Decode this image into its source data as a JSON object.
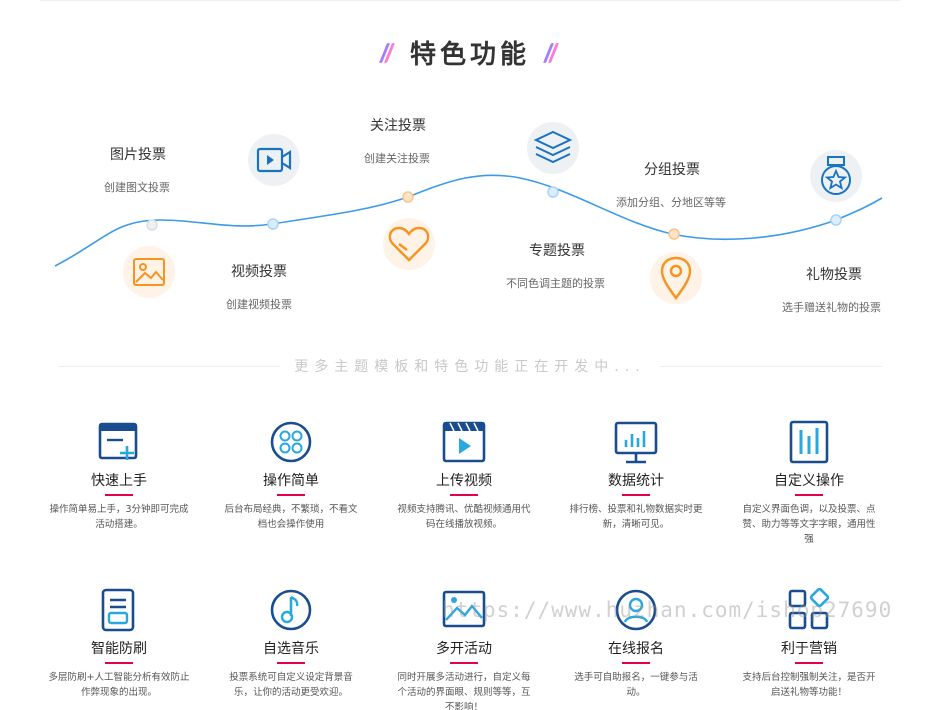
{
  "title": "特色功能",
  "timeline": [
    {
      "label": "图片投票",
      "sub": "创建图文投票",
      "icon": "image-icon"
    },
    {
      "label": "视频投票",
      "sub": "创建视频投票",
      "icon": "video-camera-icon"
    },
    {
      "label": "关注投票",
      "sub": "创建关注投票",
      "icon": "heart-icon"
    },
    {
      "label": "专题投票",
      "sub": "不同色调主题的投票",
      "icon": "layers-icon"
    },
    {
      "label": "分组投票",
      "sub": "添加分组、分地区等等",
      "icon": "location-pin-icon"
    },
    {
      "label": "礼物投票",
      "sub": "选手赠送礼物的投票",
      "icon": "medal-icon"
    }
  ],
  "divider_text": "更多主题模板和特色功能正在开发中...",
  "features": [
    {
      "title": "快速上手",
      "desc": "操作简单易上手，3分钟即可完成活动搭建。",
      "icon": "quick-add-icon"
    },
    {
      "title": "操作简单",
      "desc": "后台布局经典，不繁琐，不看文档也会操作使用",
      "icon": "grid-circle-icon"
    },
    {
      "title": "上传视频",
      "desc": "视频支持腾讯、优酷视频通用代码在线播放视频。",
      "icon": "video-play-icon"
    },
    {
      "title": "数据统计",
      "desc": "排行榜、投票和礼物数据实时更新，清晰可见。",
      "icon": "bar-chart-icon"
    },
    {
      "title": "自定义操作",
      "desc": "自定义界面色调，以及投票、点赞、助力等等文字字眼，通用性强",
      "icon": "custom-bars-icon"
    },
    {
      "title": "智能防刷",
      "desc": "多层防刷+人工智能分析有效防止作弊现象的出现。",
      "icon": "document-shield-icon"
    },
    {
      "title": "自选音乐",
      "desc": "投票系统可自定义设定背景音乐，让你的活动更受欢迎。",
      "icon": "music-note-icon"
    },
    {
      "title": "多开活动",
      "desc": "同时开展多活动进行，自定义每个活动的界面眼、规则等等，互不影响！",
      "icon": "landscape-image-icon"
    },
    {
      "title": "在线报名",
      "desc": "选手可自助报名，一键参与活动。",
      "icon": "user-icon"
    },
    {
      "title": "利于营销",
      "desc": "支持后台控制强制关注，是否开启送礼物等功能！",
      "icon": "apps-icon"
    }
  ],
  "watermark": "https://www.huzhan.com/ishop27690",
  "colors": {
    "accent_blue": "#1a72c2",
    "curve_blue": "#3b9be8",
    "orange": "#f7931e",
    "underline_red": "#e5004f"
  }
}
